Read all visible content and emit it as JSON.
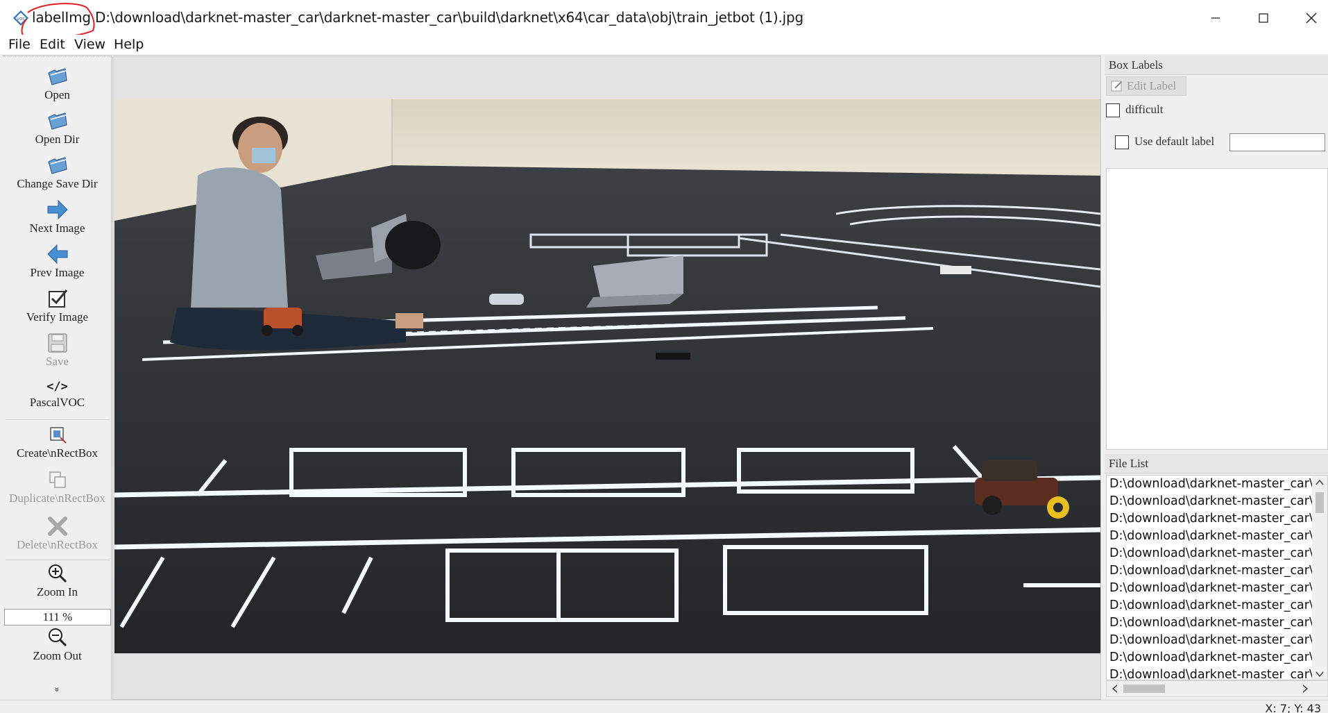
{
  "window": {
    "app_name": "labelImg",
    "file_path": "D:\\download\\darknet-master_car\\darknet-master_car\\build\\darknet\\x64\\car_data\\obj\\train_jetbot (1).jpg"
  },
  "menu": [
    "File",
    "Edit",
    "View",
    "Help"
  ],
  "toolbar": {
    "open": "Open",
    "open_dir": "Open Dir",
    "change_save_dir": "Change Save Dir",
    "next_image": "Next Image",
    "prev_image": "Prev Image",
    "verify_image": "Verify Image",
    "save": "Save",
    "format_icon_text": "</>",
    "format": "PascalVOC",
    "create_rect": "Create\\nRectBox",
    "duplicate_rect": "Duplicate\\nRectBox",
    "delete_rect": "Delete\\nRectBox",
    "zoom_in": "Zoom In",
    "zoom_value": "111 %",
    "zoom_out": "Zoom Out",
    "more": "»"
  },
  "box_labels": {
    "title": "Box Labels",
    "edit_label": "Edit Label",
    "difficult": "difficult",
    "use_default_label": "Use default label",
    "default_label_value": ""
  },
  "file_list": {
    "title": "File List",
    "items": [
      "D:\\download\\darknet-master_car\\d",
      "D:\\download\\darknet-master_car\\d",
      "D:\\download\\darknet-master_car\\d",
      "D:\\download\\darknet-master_car\\d",
      "D:\\download\\darknet-master_car\\d",
      "D:\\download\\darknet-master_car\\d",
      "D:\\download\\darknet-master_car\\d",
      "D:\\download\\darknet-master_car\\d",
      "D:\\download\\darknet-master_car\\d",
      "D:\\download\\darknet-master_car\\d",
      "D:\\download\\darknet-master_car\\d",
      "D:\\download\\darknet-master_car\\d"
    ]
  },
  "status": "X: 7; Y: 43",
  "colors": {
    "annotation_red": "#e02020",
    "arrow_blue": "#3b7fc4",
    "floor": "#2a2c2e",
    "tape": "#f4f8ff"
  }
}
